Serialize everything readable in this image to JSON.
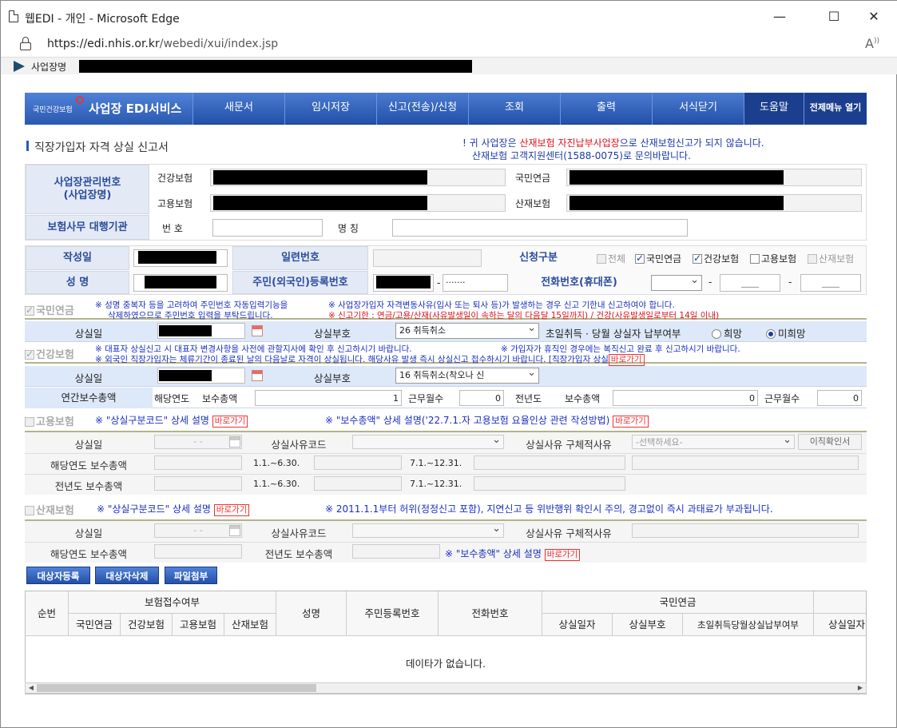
{
  "browser": {
    "title": "웹EDI - 개인 - Microsoft Edge",
    "url_prefix": "https://edi.nhis.or.kr",
    "url_path": "/webedi/xui/index.jsp",
    "minimize": "—",
    "maximize": "☐",
    "close": "✕"
  },
  "bizbar": {
    "label": "사업장명"
  },
  "nav": {
    "logo_small": "국민건강보험",
    "logo_title": "사업장 EDI서비스",
    "items": [
      "새문서",
      "임시저장",
      "신고(전송)/신청",
      "조회",
      "출력",
      "서식닫기"
    ],
    "help": "도움말",
    "all_menu": "전제메뉴 열기"
  },
  "form": {
    "title": "직장가입자 자격 상실 신고서",
    "notice_pre": "! 귀 사업장은 ",
    "notice_red": "산재보험 자진납부사업장",
    "notice_post": "으로 산재보험신고가 되지 않습니다.",
    "notice_line2": "산재보험 고객지원센터(1588-0075)로 문의바랍니다.",
    "biz_num_label": "사업장관리번호\n(사업장명)",
    "health_label": "건강보험",
    "employ_label": "고용보험",
    "pension_label": "국민연금",
    "accident_label": "산재보험",
    "agency_label": "보험사무 대행기관",
    "agency_num": "번 호",
    "agency_name": "명 칭",
    "created_label": "작성일",
    "serial_label": "일련번호",
    "apply_label": "신청구분",
    "apply_all": "전체",
    "apply_pension": "국민연금",
    "apply_health": "건강보험",
    "apply_employ": "고용보험",
    "apply_accident": "산재보험",
    "name_label": "성   명",
    "rrn_label": "주민(외국인)등록번호",
    "rrn_masked": "·······",
    "phone_label": "전화번호(휴대폰)",
    "phone_mid": "____",
    "phone_last": "____",
    "dash": "-"
  },
  "pension": {
    "label": "국민연금",
    "note1": "※ 성명 중복자 등을 고려하여 주민번호 자동입력기능을",
    "note1b": "삭제하였으므로 주민번호 입력을 부탁드립니다.",
    "note2": "※ 사업장가입자 자격변동사유(입사 또는 퇴사 등)가 발생하는 경우 신고 기한내 신고하여야 합니다.",
    "note3": "※ 신고기한 : 연금/고용/산재(사유발생일이 속하는 달의 다음달 15일까지) / 건강(사유발생일로부터 14일 이내)",
    "loss_date_label": "상실일",
    "loss_code_label": "상실부호",
    "loss_code_value": "26        취득취소",
    "pay_label": "초일취득 · 당월 상실자 납부여부",
    "hope": "희망",
    "no_hope": "미희망"
  },
  "health": {
    "label": "건강보험",
    "note1": "※ 대표자 상실신고 시 대표자 변경사항을 사전에 관할지사에 확인 후 신고하시기 바랍니다.",
    "note2": "※ 가입자가 휴직인 경우에는 복직신고 완료 후 신고하시기 바랍니다.",
    "note3": "※ 외국인 직장가입자는 체류기간이 종료된 날의 다음날로 자격이 상실됩니다. 해당사유 발생 즉시 상실신고 접수하시기 바랍니다. [직장가입자 상실",
    "goto": "바로가기",
    "loss_date_label": "상실일",
    "loss_code_label": "상실부호",
    "loss_code_value": "16        취득취소(착오나 신",
    "annual_label": "연간보수총액",
    "cur_year": "해당연도",
    "pay_total": "보수총액",
    "pay_value": "1",
    "work_months": "근무월수",
    "work_value": "0",
    "prev_year": "전년도",
    "prev_pay_total": "보수총액",
    "prev_pay_value": "0",
    "prev_work_months": "근무월수",
    "prev_work_value": "0"
  },
  "employ": {
    "label": "고용보험",
    "note1": "※ \"상실구분코드\" 상세 설명",
    "note2": "※ \"보수총액\" 상세 설명('22.7.1.자 고용보험 요율인상 관련 작성방법)",
    "goto": "바로가기",
    "loss_date_label": "상실일",
    "date_placeholder": "-  -",
    "reason_code_label": "상실사유코드",
    "reason_detail_label": "상실사유 구체적사유",
    "reason_select": "-선택하세요-",
    "cert_button": "이직확인서",
    "cur_pay_label": "해당연도 보수총액",
    "prev_pay_label": "전년도 보수총액",
    "period1": "1.1.~6.30.",
    "period2": "7.1.~12.31."
  },
  "accident": {
    "label": "산재보험",
    "note1": "※ \"상실구분코드\" 상세 설명",
    "note2": "※ 2011.1.1부터 허위(정정신고 포함), 지연신고 등 위반행위 확인시 주의, 경고없이 즉시 과태료가 부과됩니다.",
    "goto": "바로가기",
    "loss_date_label": "상실일",
    "date_placeholder": "-  -",
    "reason_code_label": "상실사유코드",
    "reason_detail_label": "상실사유 구체적사유",
    "cur_pay_label": "해당연도 보수총액",
    "prev_pay_label": "전년도 보수총액",
    "pay_note": "※ \"보수총액\" 상세 설명"
  },
  "buttons": {
    "register": "대상자등록",
    "delete": "대상자삭제",
    "attach": "파일첨부"
  },
  "table": {
    "seq": "순번",
    "received": "보험접수여부",
    "sub": [
      "국민연금",
      "건강보험",
      "고용보험",
      "산재보험"
    ],
    "name": "성명",
    "rrn": "주민등록번호",
    "phone": "전화번호",
    "pension": "국민연금",
    "pension_sub": [
      "상실일자",
      "상실부호",
      "초일취득당월상실납부여부",
      "상실일자"
    ],
    "empty": "데이타가 없습니다."
  }
}
